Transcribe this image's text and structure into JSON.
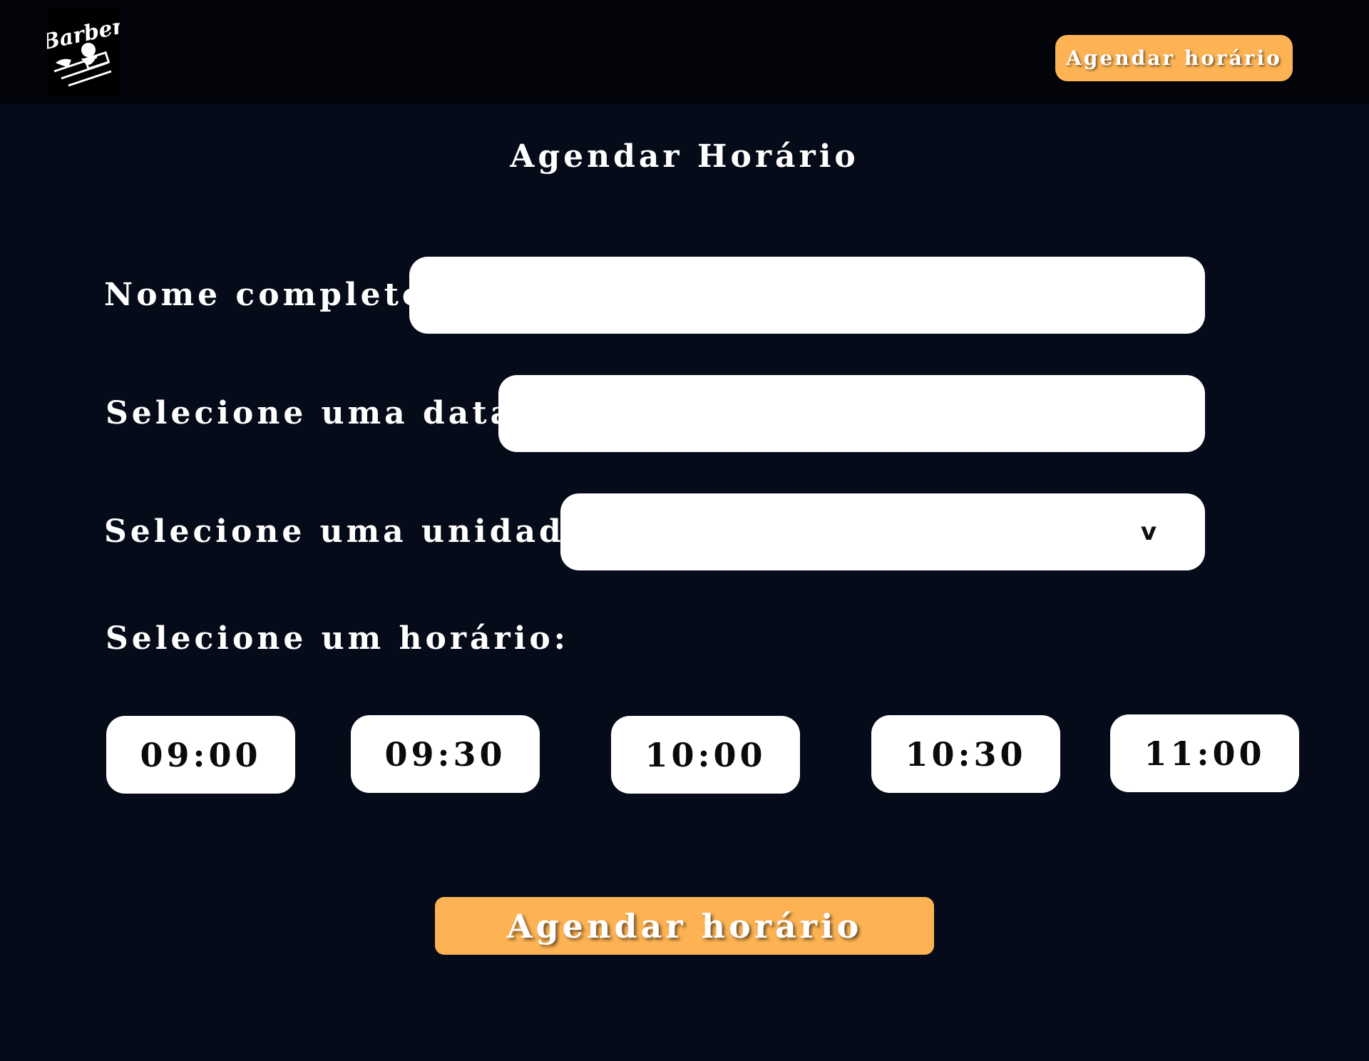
{
  "header": {
    "logo_text": "Barber",
    "cta_label": "Agendar horário"
  },
  "form": {
    "title": "Agendar Horário",
    "name_label": "Nome completo:",
    "name_value": "",
    "date_label": "Selecione uma data:",
    "date_value": "",
    "unit_label": "Selecione uma unidade:",
    "unit_value": "",
    "unit_chevron": "v",
    "time_label": "Selecione um horário:",
    "time_slots": [
      "09:00",
      "09:30",
      "10:00",
      "10:30",
      "11:00"
    ],
    "submit_label": "Agendar horário"
  },
  "colors": {
    "background": "#050b18",
    "header_background": "#020409",
    "accent": "#fdb353"
  },
  "icons": {
    "logo": "barber-logo",
    "select": "chevron-down-icon"
  }
}
